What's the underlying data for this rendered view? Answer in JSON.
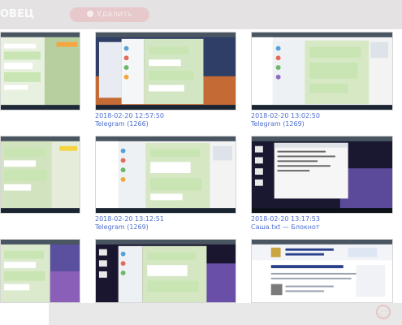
{
  "header": {
    "title": "ОВЕЦ",
    "pill_label": "Удалить"
  },
  "colors": {
    "link": "#4d6fd0",
    "header_bg": "#e4e2e2",
    "telegram_green": "#c9e5b4",
    "night_purple": "#2d2950"
  },
  "thumbnails": [
    {
      "id": "t1",
      "date": "",
      "title": "",
      "style": "telegram-day"
    },
    {
      "id": "t2",
      "date": "2018-02-20 12:57:50",
      "title": "Telegram (1266)",
      "style": "telegram-night"
    },
    {
      "id": "t3",
      "date": "2018-02-20 13:02:50",
      "title": "Telegram (1269)",
      "style": "telegram-day"
    },
    {
      "id": "t4",
      "date": "",
      "title": "",
      "style": "telegram-day"
    },
    {
      "id": "t5",
      "date": "2018-02-20 13:12:51",
      "title": "Telegram (1269)",
      "style": "telegram-day"
    },
    {
      "id": "t6",
      "date": "2018-02-20 13:17:53",
      "title": "Саша.txt — Блокнот",
      "style": "notepad-dark"
    },
    {
      "id": "t7",
      "date": "",
      "title": "",
      "style": "telegram-purple"
    },
    {
      "id": "t8",
      "date": "",
      "title": "",
      "style": "telegram-dark"
    },
    {
      "id": "t9",
      "date": "",
      "title": "",
      "style": "website"
    }
  ],
  "bottom": {
    "mark_icon": "circle-mark-icon"
  }
}
